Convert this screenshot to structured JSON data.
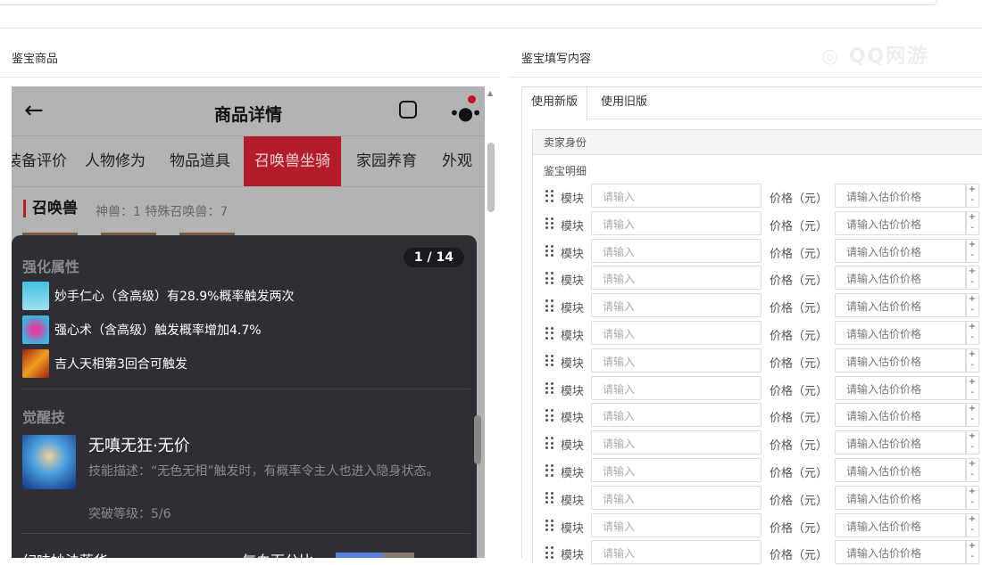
{
  "left_panel": {
    "title": "鉴宝商品"
  },
  "right_panel": {
    "title": "鉴宝填写内容",
    "watermark": "QQ网游"
  },
  "phone": {
    "header_title": "商品详情",
    "tabs": [
      "装备评价",
      "人物修为",
      "物品道具",
      "召唤兽坐骑",
      "家园养育",
      "外观"
    ],
    "active_tab": "召唤兽坐骑",
    "section": "召唤兽",
    "section_meta": "神兽：1  特殊召唤兽：7",
    "overlay": {
      "counter": "1 / 14",
      "enhance_title": "强化属性",
      "attrs": [
        "妙手仁心（含高级）有28.9%概率触发两次",
        "强心术（含高级）触发概率增加4.7%",
        "吉人天相第3回合可触发"
      ],
      "awaken_title": "觉醒技",
      "skill_name": "无嗔无狂·无价",
      "skill_desc": "技能描述：“无色无相”触发时，有概率令主人也进入隐身状态。",
      "skill_level": "突破等级：5/6",
      "bottom_left": "幻味妙法莲华",
      "bottom_mid": "气血百分比:",
      "hp_fraction": 0.6
    }
  },
  "form": {
    "tabs": [
      "使用新版",
      "使用旧版"
    ],
    "seller_label": "卖家身份",
    "detail_label": "鉴宝明细",
    "module_label": "模块",
    "module_placeholder": "请输入",
    "price_label": "价格（元）",
    "price_placeholder": "请输入估价价格",
    "plus": "+",
    "minus": "-",
    "remove": "✕",
    "row_count": 14
  }
}
